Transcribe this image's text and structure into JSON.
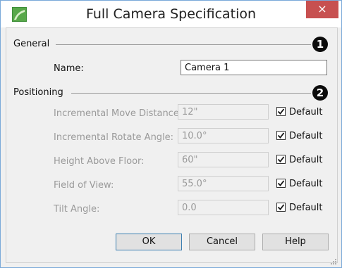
{
  "window": {
    "title": "Full Camera Specification",
    "close_glyph": "×",
    "icon": "app-logo-icon"
  },
  "general": {
    "section_label": "General",
    "callout": "1",
    "name_label": "Name:",
    "name_value": "Camera 1"
  },
  "positioning": {
    "section_label": "Positioning",
    "callout": "2",
    "rows": [
      {
        "label": "Incremental Move Distance:",
        "value": "12\"",
        "default_label": "Default",
        "default_checked": true
      },
      {
        "label": "Incremental Rotate Angle:",
        "value": "10.0°",
        "default_label": "Default",
        "default_checked": true
      },
      {
        "label": "Height Above Floor:",
        "value": "60\"",
        "default_label": "Default",
        "default_checked": true
      },
      {
        "label": "Field of View:",
        "value": "55.0°",
        "default_label": "Default",
        "default_checked": true
      },
      {
        "label": "Tilt Angle:",
        "value": "0.0",
        "default_label": "Default",
        "default_checked": true
      }
    ]
  },
  "buttons": {
    "ok": "OK",
    "cancel": "Cancel",
    "help": "Help"
  },
  "colors": {
    "close_button": "#c75050",
    "callout": "#0c0c0c",
    "window_border": "#7aa9d9"
  }
}
